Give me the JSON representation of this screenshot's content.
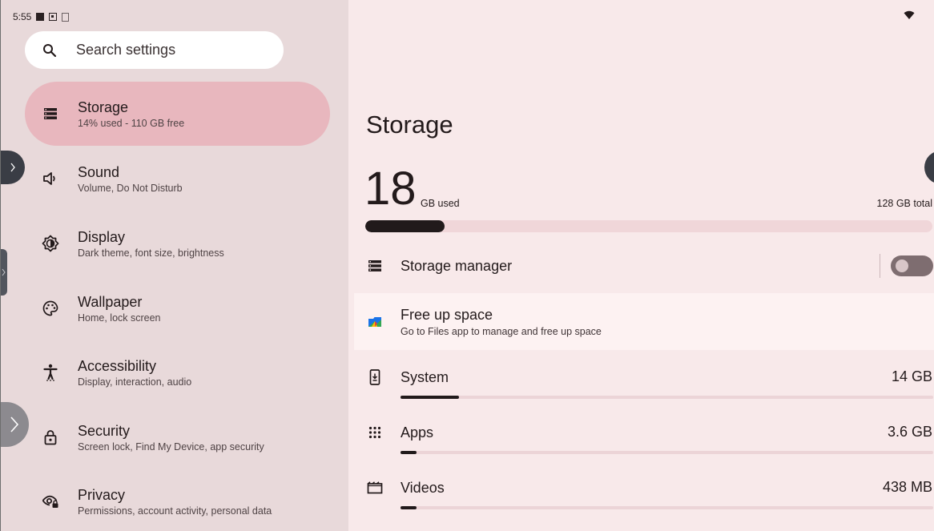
{
  "status_bar": {
    "time": "5:55"
  },
  "search": {
    "placeholder": "Search settings"
  },
  "nav": [
    {
      "id": "storage",
      "title": "Storage",
      "subtitle": "14% used - 110 GB free",
      "icon": "storage-icon",
      "active": true
    },
    {
      "id": "sound",
      "title": "Sound",
      "subtitle": "Volume, Do Not Disturb",
      "icon": "volume-icon"
    },
    {
      "id": "display",
      "title": "Display",
      "subtitle": "Dark theme, font size, brightness",
      "icon": "brightness-icon"
    },
    {
      "id": "wallpaper",
      "title": "Wallpaper",
      "subtitle": "Home, lock screen",
      "icon": "palette-icon"
    },
    {
      "id": "accessibility",
      "title": "Accessibility",
      "subtitle": "Display, interaction, audio",
      "icon": "accessibility-icon"
    },
    {
      "id": "security",
      "title": "Security",
      "subtitle": "Screen lock, Find My Device, app security",
      "icon": "lock-icon"
    },
    {
      "id": "privacy",
      "title": "Privacy",
      "subtitle": "Permissions, account activity, personal data",
      "icon": "privacy-eye-icon"
    }
  ],
  "detail": {
    "title": "Storage",
    "used_value": "18",
    "used_unit": "GB used",
    "total": "128 GB total",
    "used_fraction": 0.14,
    "storage_manager": {
      "label": "Storage manager",
      "enabled": false
    },
    "free_up": {
      "title": "Free up space",
      "subtitle": "Go to Files app to manage and free up space"
    },
    "categories": [
      {
        "name": "System",
        "value": "14 GB",
        "fraction": 0.11,
        "icon": "system-update-icon"
      },
      {
        "name": "Apps",
        "value": "3.6 GB",
        "fraction": 0.03,
        "icon": "apps-grid-icon"
      },
      {
        "name": "Videos",
        "value": "438 MB",
        "fraction": 0.004,
        "icon": "movie-icon"
      }
    ]
  },
  "colors": {
    "active_nav": "#e8b7be",
    "left_bg": "#e8d9da",
    "right_bg": "#f8e9ea",
    "bar_fill": "#211a1b"
  }
}
